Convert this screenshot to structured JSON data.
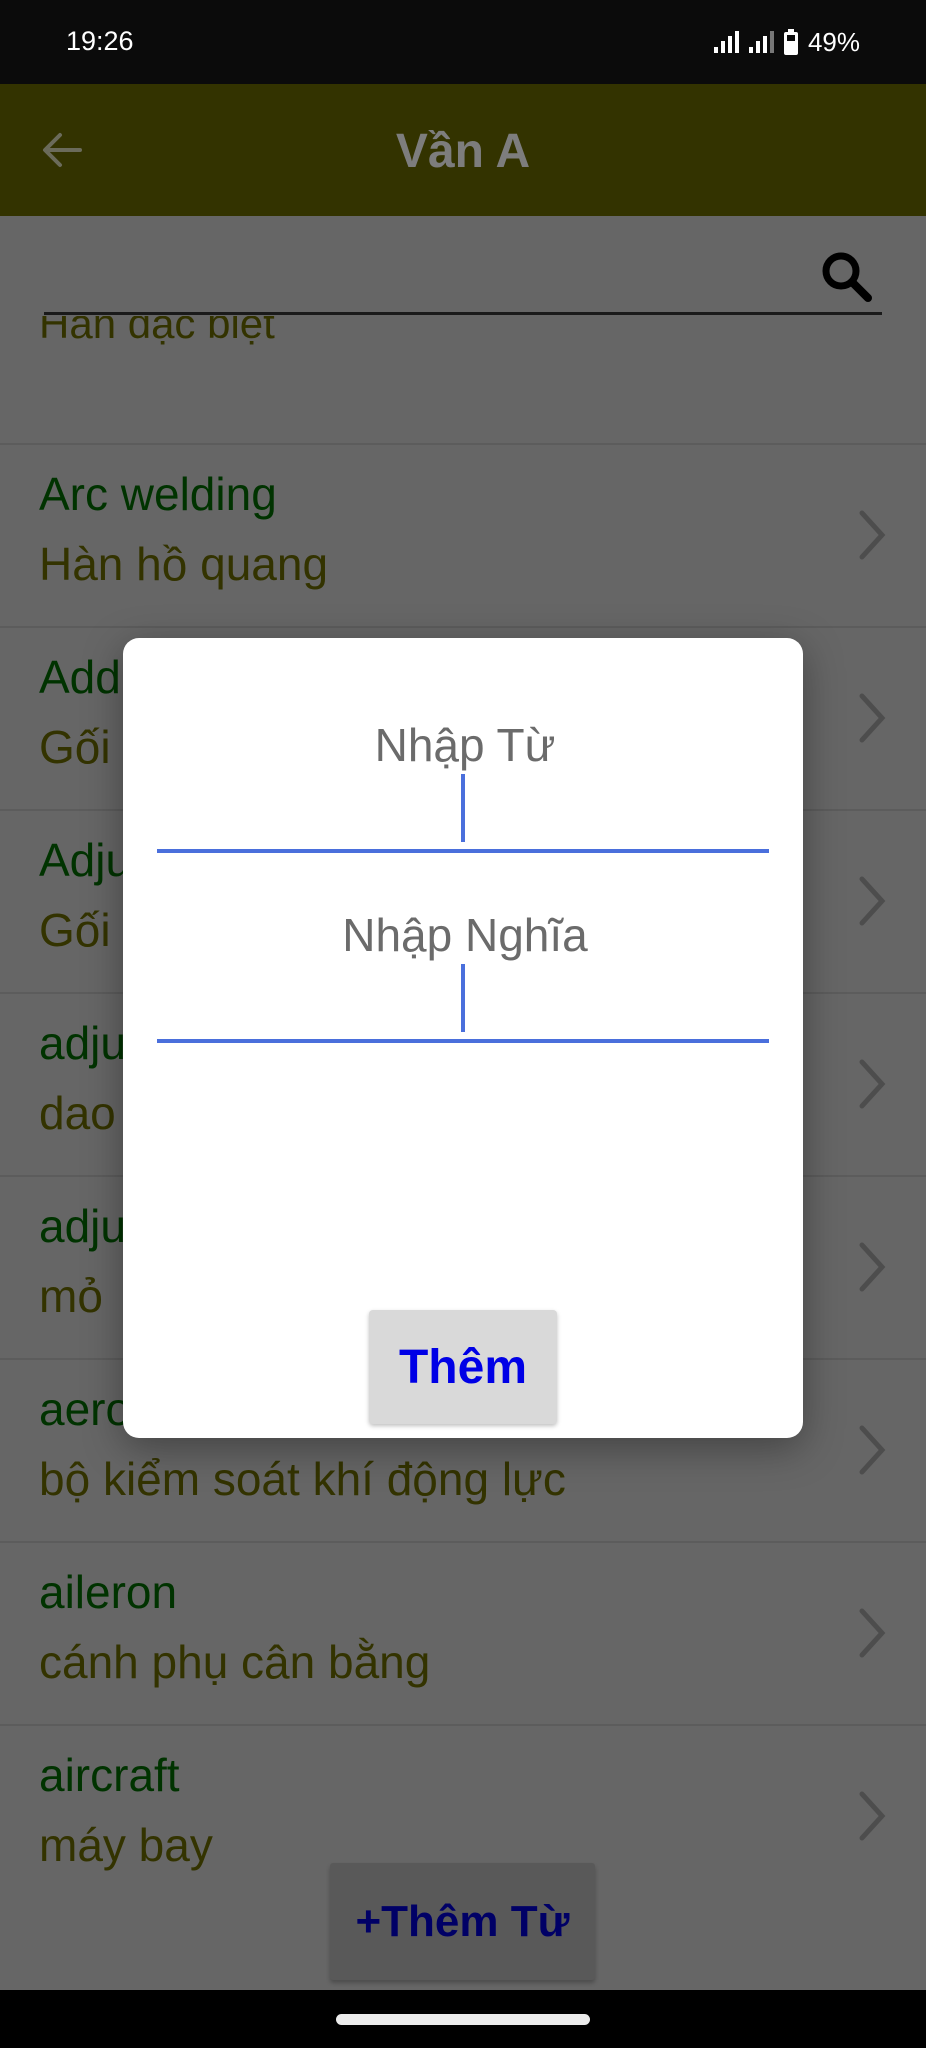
{
  "status_bar": {
    "time": "19:26",
    "battery_percent": "49%",
    "icons": [
      "signal-sim1-icon",
      "signal-sim2-icon",
      "battery-icon"
    ]
  },
  "app_bar": {
    "title": "Vần A",
    "back_icon": "arrow-left-icon"
  },
  "search": {
    "value": "",
    "placeholder": "",
    "icon": "search-icon"
  },
  "list": {
    "partial_meaning": "Hàn đặc biệt",
    "items": [
      {
        "word": "Arc welding",
        "meaning": "Hàn hồ quang"
      },
      {
        "word": "Add",
        "meaning": "Gối"
      },
      {
        "word": "Adju",
        "meaning": "Gối"
      },
      {
        "word": "adju",
        "meaning": "dao"
      },
      {
        "word": "adju",
        "meaning": "mỏ"
      },
      {
        "word": "aero",
        "meaning": "bộ kiểm soát khí động lực"
      },
      {
        "word": "aileron",
        "meaning": "cánh phụ cân bằng"
      },
      {
        "word": "aircraft",
        "meaning": "máy bay"
      }
    ]
  },
  "add_word_button": {
    "label": "+Thêm Từ"
  },
  "dialog": {
    "word_field": {
      "value": "",
      "placeholder": "Nhập Từ"
    },
    "meaning_field": {
      "value": "",
      "placeholder": "Nhập Nghĩa"
    },
    "submit_label": "Thêm",
    "accent_color": "#4a6fdc",
    "submit_text_color": "#0000e6"
  },
  "colors": {
    "app_bar": "#333300",
    "word_text": "#003300",
    "meaning_text": "#333300"
  }
}
